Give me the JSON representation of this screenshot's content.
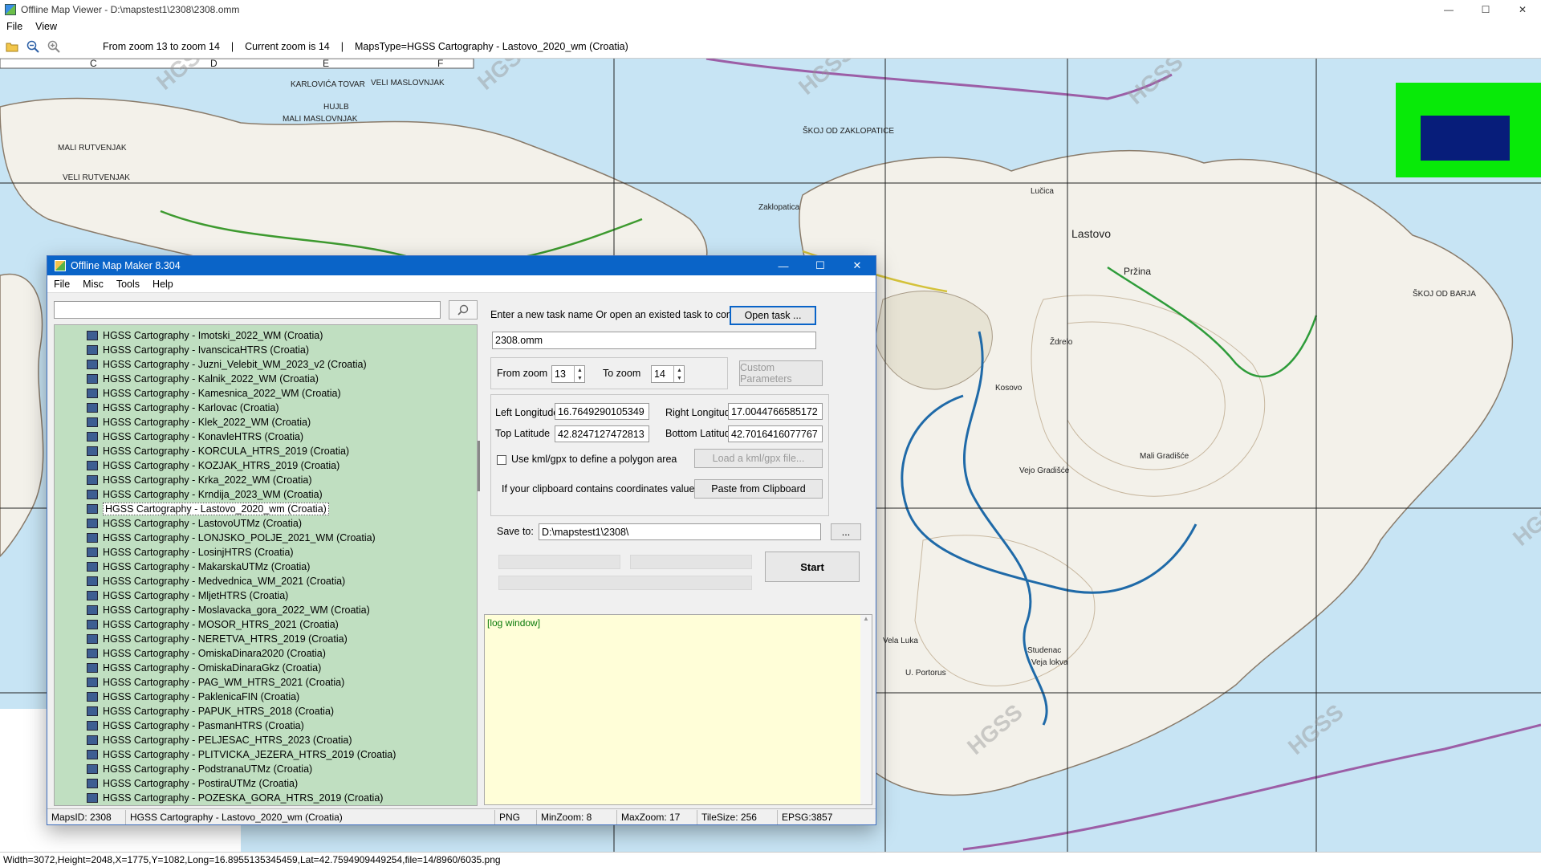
{
  "window": {
    "title": "Offline Map Viewer - D:\\mapstest1\\2308\\2308.omm",
    "controls": [
      "—",
      "☐",
      "✕"
    ]
  },
  "menu": [
    "File",
    "View"
  ],
  "toolbar": {
    "status_zoom_range": "From zoom 13 to zoom 14",
    "status_current_zoom": "Current zoom is 14",
    "status_maps_type": "MapsType=HGSS Cartography - Lastovo_2020_wm (Croatia)",
    "separator": "|"
  },
  "map": {
    "grid_letters": [
      "C",
      "D",
      "E",
      "F"
    ],
    "labels": [
      "KARLOVIĆA TOVAR",
      "VELI MASLOVNJAK",
      "HUJLB",
      "MALI MASLOVNJAK",
      "MALI RUTVENJAK",
      "VELI RUTVENJAK",
      "Zaklopatica",
      "ŠKOJ OD ZAKLOPATICE",
      "Lučica",
      "Lastovo",
      "Pržina",
      "ŠKOJ OD BARJA",
      "Kosovo",
      "Vejo Gradišće",
      "Veja lokva",
      "Studenac",
      "Ždrelo",
      "Mali Gradišće",
      "Vela Luka",
      "U. Portorus",
      "HGSS"
    ],
    "watermark": "HGSS",
    "minimap_colors": {
      "background": "#08ea08",
      "viewport": "#071d7a"
    }
  },
  "bottom_status": "Width=3072,Height=2048,X=1775,Y=1082,Long=16.8955135345459,Lat=42.7594909449254,file=14/8960/6035.png",
  "dialog": {
    "title": "Offline Map Maker 8.304",
    "controls": [
      "—",
      "☐",
      "✕"
    ],
    "menu": [
      "File",
      "Misc",
      "Tools",
      "Help"
    ],
    "search_placeholder": "",
    "search_icon": "search-icon",
    "tree_items": [
      "HGSS Cartography - Imotski_2022_WM (Croatia)",
      "HGSS Cartography - IvanscicaHTRS (Croatia)",
      "HGSS Cartography - Juzni_Velebit_WM_2023_v2 (Croatia)",
      "HGSS Cartography - Kalnik_2022_WM (Croatia)",
      "HGSS Cartography - Kamesnica_2022_WM (Croatia)",
      "HGSS Cartography - Karlovac (Croatia)",
      "HGSS Cartography - Klek_2022_WM (Croatia)",
      "HGSS Cartography - KonavleHTRS (Croatia)",
      "HGSS Cartography - KORCULA_HTRS_2019 (Croatia)",
      "HGSS Cartography - KOZJAK_HTRS_2019 (Croatia)",
      "HGSS Cartography - Krka_2022_WM (Croatia)",
      "HGSS Cartography - Krndija_2023_WM (Croatia)",
      "HGSS Cartography - Lastovo_2020_wm (Croatia)",
      "HGSS Cartography - LastovoUTMz (Croatia)",
      "HGSS Cartography - LONJSKO_POLJE_2021_WM (Croatia)",
      "HGSS Cartography - LosinjHTRS (Croatia)",
      "HGSS Cartography - MakarskaUTMz (Croatia)",
      "HGSS Cartography - Medvednica_WM_2021 (Croatia)",
      "HGSS Cartography - MljetHTRS (Croatia)",
      "HGSS Cartography - Moslavacka_gora_2022_WM (Croatia)",
      "HGSS Cartography - MOSOR_HTRS_2021 (Croatia)",
      "HGSS Cartography - NERETVA_HTRS_2019 (Croatia)",
      "HGSS Cartography - OmiskaDinara2020 (Croatia)",
      "HGSS Cartography - OmiskaDinaraGkz (Croatia)",
      "HGSS Cartography - PAG_WM_HTRS_2021 (Croatia)",
      "HGSS Cartography - PaklenicaFIN (Croatia)",
      "HGSS Cartography - PAPUK_HTRS_2018 (Croatia)",
      "HGSS Cartography - PasmanHTRS (Croatia)",
      "HGSS Cartography - PELJESAC_HTRS_2023 (Croatia)",
      "HGSS Cartography - PLITVICKA_JEZERA_HTRS_2019 (Croatia)",
      "HGSS Cartography - PodstranaUTMz (Croatia)",
      "HGSS Cartography - PostiraUTMz (Croatia)",
      "HGSS Cartography - POZESKA_GORA_HTRS_2019 (Croatia)"
    ],
    "selected_item_index": 12,
    "task_prompt": "Enter a new task name Or open an existed task to continue:",
    "open_task_label": "Open task ...",
    "task_name": "2308.omm",
    "from_zoom_label": "From zoom",
    "from_zoom": "13",
    "to_zoom_label": "To zoom",
    "to_zoom": "14",
    "custom_params_label": "Custom Parameters",
    "left_lon_label": "Left Longitude",
    "left_lon": "16.7649290105349",
    "right_lon_label": "Right Longitude",
    "right_lon": "17.0044766585172",
    "top_lat_label": "Top Latitude",
    "top_lat": "42.8247127472813",
    "bottom_lat_label": "Bottom Latitude",
    "bottom_lat": "42.7016416077767",
    "kml_label": "Use kml/gpx to define a polygon area",
    "load_kml_label": "Load a kml/gpx file...",
    "clipboard_prompt": "If your clipboard contains coordinates values:",
    "paste_label": "Paste from Clipboard",
    "save_to_label": "Save to:",
    "save_to": "D:\\mapstest1\\2308\\",
    "browse_label": "...",
    "start_label": "Start",
    "log_text": "[log window]",
    "status": {
      "maps_id": "MapsID: 2308",
      "maps_name": "HGSS Cartography - Lastovo_2020_wm (Croatia)",
      "format": "PNG",
      "min_zoom": "MinZoom: 8",
      "max_zoom": "MaxZoom: 17",
      "tile_size": "TileSize: 256",
      "epsg": "EPSG:3857"
    }
  }
}
